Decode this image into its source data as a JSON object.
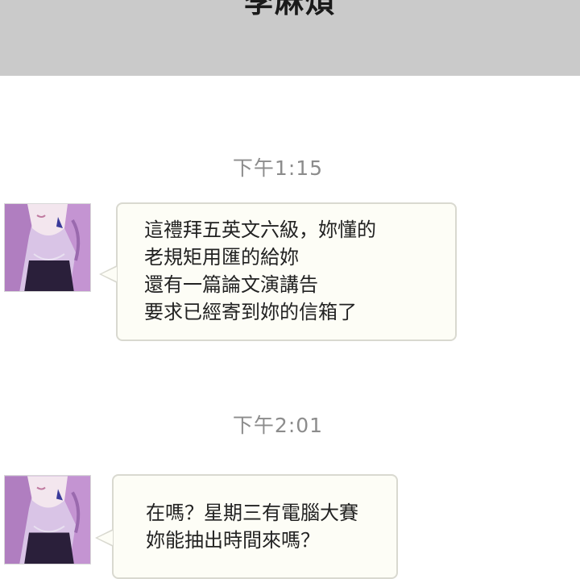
{
  "header": {
    "title": "李麻煩"
  },
  "messages": [
    {
      "timestamp": "下午1:15",
      "lines": [
        "這禮拜五英文六級，妳懂的",
        "老規矩用匯的給妳",
        "還有一篇論文演講告",
        "要求已經寄到妳的信箱了"
      ]
    },
    {
      "timestamp": "下午2:01",
      "lines": [
        "在嗎？星期三有電腦大賽",
        "妳能抽出時間來嗎？"
      ]
    }
  ],
  "colors": {
    "header_bg": "#cacaca",
    "bubble_bg": "#fdfdf6",
    "bubble_border": "#d9d9d0",
    "timestamp": "#8c8c8c"
  },
  "icons": [
    "avatar"
  ]
}
